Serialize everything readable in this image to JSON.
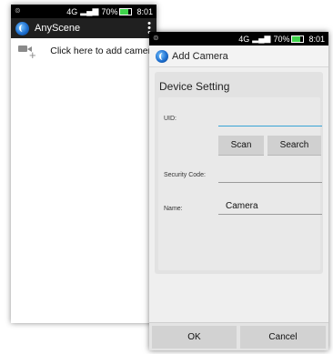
{
  "status_bar": {
    "signal_label": "4G",
    "battery_percent": "70%",
    "time": "8:01"
  },
  "main_screen": {
    "app_title": "AnyScene",
    "overflow_menu": "⋮",
    "add_camera_text": "Click here to add camera"
  },
  "dialog": {
    "title": "Add Camera",
    "section_title": "Device Setting",
    "uid_label": "UID:",
    "uid_value": "",
    "scan_button": "Scan",
    "search_button": "Search",
    "security_code_label": "Security Code:",
    "security_code_value": "",
    "name_label": "Name:",
    "name_value": "Camera",
    "ok_button": "OK",
    "cancel_button": "Cancel"
  },
  "icons": {
    "app_logo": "app-logo-icon",
    "add_camera": "camera-plus-icon",
    "overflow": "overflow-menu-icon"
  },
  "colors": {
    "status_bar": "#000000",
    "action_bar": "#202020",
    "focus_underline": "#38a3d6",
    "battery": "#3fd34b"
  }
}
